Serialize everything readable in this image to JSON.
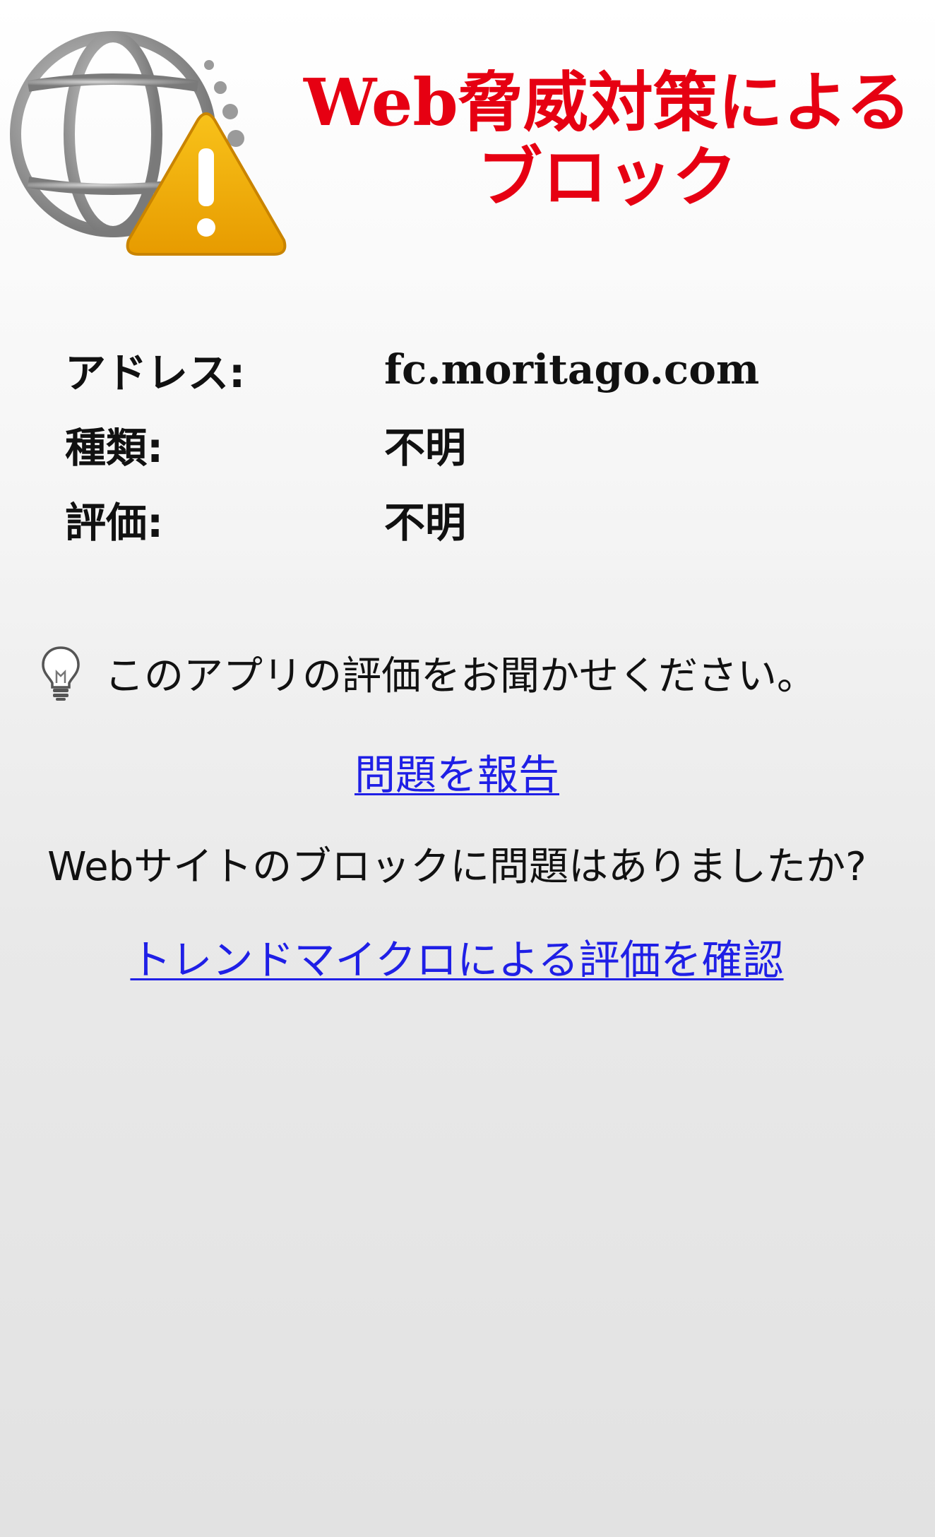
{
  "header": {
    "title_line1": "Web脅威対策による",
    "title_line2": "ブロック",
    "logo_icon": "globe-warning-icon",
    "title_color": "#e60012"
  },
  "info": {
    "address_label": "アドレス:",
    "address_value": "fc.moritago.com",
    "type_label": "種類:",
    "type_value": "不明",
    "rating_label": "評価:",
    "rating_value": "不明"
  },
  "feedback": {
    "icon": "lightbulb-icon",
    "text": "このアプリの評価をお聞かせください。"
  },
  "links": {
    "report_problem": "問題を報告",
    "question": "Webサイトのブロックに問題はありましたか?",
    "check_rating": "トレンドマイクロによる評価を確認",
    "link_color": "#1f1fe6"
  }
}
